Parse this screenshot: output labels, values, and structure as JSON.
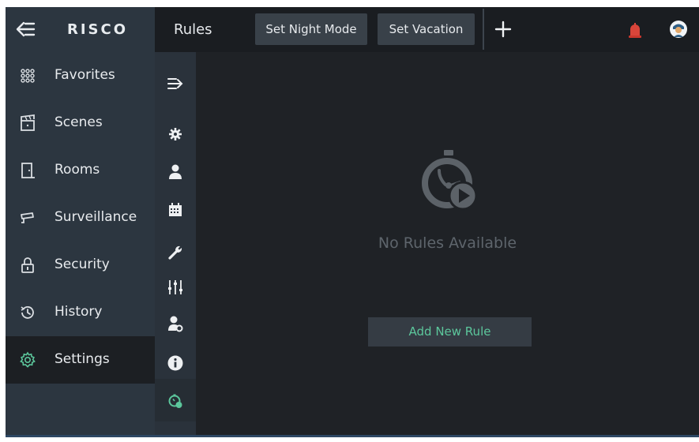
{
  "app": {
    "logo_text": "RISCO",
    "colors": {
      "accent": "#5cc79c",
      "sidebar": "#2c3640",
      "background": "#1f2226",
      "alarm": "#d9453a"
    }
  },
  "header": {
    "back_icon": "arrow-left-icon",
    "title": "Rules",
    "buttons": [
      {
        "label": "Set Night Mode"
      },
      {
        "label": "Set Vacation"
      }
    ],
    "add_icon": "plus-icon",
    "alarm_icon": "siren-icon",
    "avatar_icon": "user-avatar-icon"
  },
  "sidebar": {
    "items": [
      {
        "label": "Favorites",
        "icon": "grid-dots-icon"
      },
      {
        "label": "Scenes",
        "icon": "clapperboard-icon"
      },
      {
        "label": "Rooms",
        "icon": "door-icon"
      },
      {
        "label": "Surveillance",
        "icon": "camera-icon"
      },
      {
        "label": "Security",
        "icon": "lock-icon"
      },
      {
        "label": "History",
        "icon": "history-icon"
      },
      {
        "label": "Settings",
        "icon": "gear-icon",
        "active": true
      }
    ]
  },
  "icon_column": {
    "icons": [
      "expand-arrow-icon",
      "gear-icon",
      "user-icon",
      "calendar-icon",
      "wrench-icon",
      "sliders-icon",
      "user-settings-icon",
      "info-icon",
      "rules-icon"
    ],
    "active": "rules-icon"
  },
  "main": {
    "empty_icon": "stopwatch-play-icon",
    "empty_text": "No Rules Available",
    "add_button_label": "Add New Rule"
  }
}
